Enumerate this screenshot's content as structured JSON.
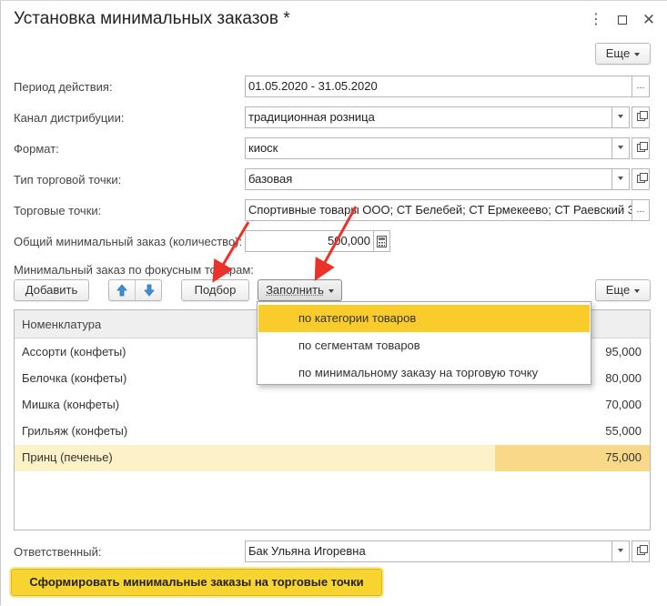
{
  "window": {
    "title": "Установка минимальных заказов *",
    "kebab": "⋮",
    "close": "✕"
  },
  "toolbar": {
    "more_label": "Еще"
  },
  "fields": {
    "period": {
      "label": "Период действия:",
      "value": "01.05.2020 - 31.05.2020",
      "btn": "..."
    },
    "channel": {
      "label": "Канал дистрибуции:",
      "value": "традиционная розница"
    },
    "format": {
      "label": "Формат:",
      "value": "киоск"
    },
    "outlet_type": {
      "label": "Тип торговой точки:",
      "value": "базовая"
    },
    "outlets": {
      "label": "Торговые точки:",
      "value": "Спортивные товары ООО; СТ Белебей; СТ Ермекеево; СТ Раевский ЗАО",
      "btn": "..."
    },
    "total_min": {
      "label": "Общий минимальный заказ (количество):",
      "value": "500,000"
    }
  },
  "focus_section": {
    "label": "Минимальный заказ по фокусным товарам:",
    "add_label": "Добавить",
    "pick_label": "Подбор",
    "fill_label": "Заполнить",
    "more_label": "Еще"
  },
  "table": {
    "column": "Номенклатура",
    "rows": [
      {
        "name": "Ассорти (конфеты)",
        "value": "95,000"
      },
      {
        "name": "Белочка (конфеты)",
        "value": "80,000"
      },
      {
        "name": "Мишка (конфеты)",
        "value": "70,000"
      },
      {
        "name": "Грильяж (конфеты)",
        "value": "55,000"
      },
      {
        "name": "Принц (печенье)",
        "value": "75,000"
      }
    ]
  },
  "fill_menu": {
    "items": [
      "по категории товаров",
      "по сегментам товаров",
      "по минимальному заказу на торговую точку"
    ],
    "active_index": 0
  },
  "responsible": {
    "label": "Ответственный:",
    "value": "Бак Ульяна Игоревна"
  },
  "generate_label": "Сформировать минимальные заказы на торговые точки",
  "colors": {
    "accent_yellow": "#f9cc2b",
    "selected_row": "#fdf2c7",
    "selected_cell": "#f8d889",
    "arrow_red": "#e8322a"
  }
}
